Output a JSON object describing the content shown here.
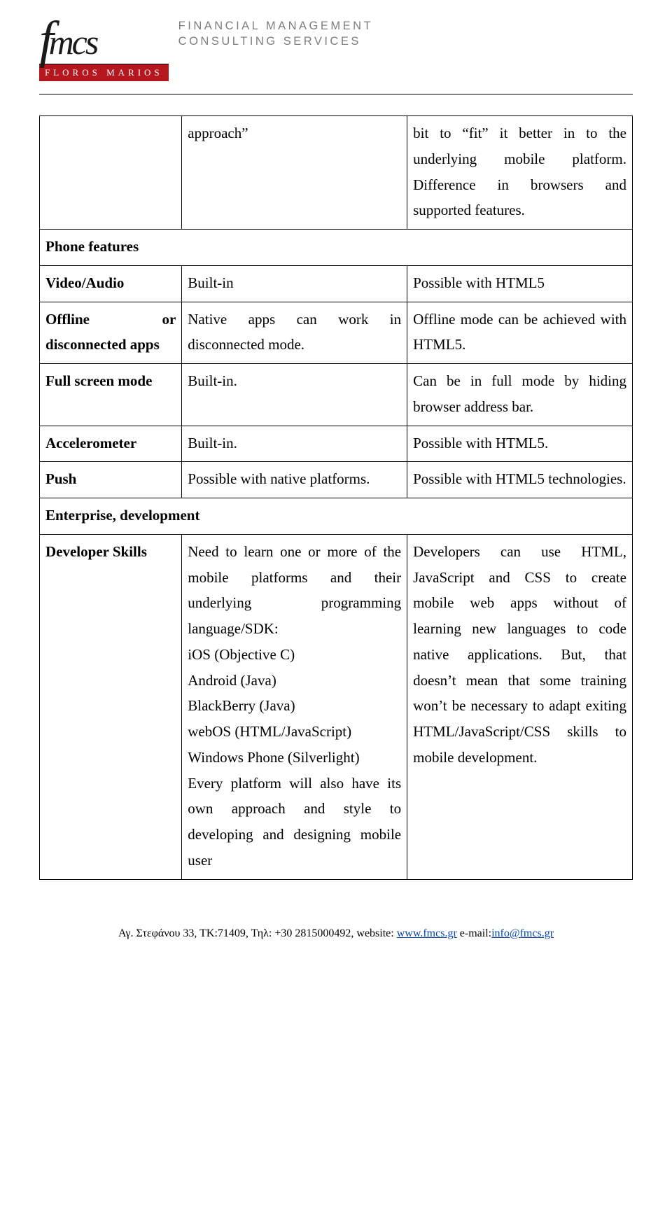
{
  "header": {
    "logo_text": "fmcs",
    "logo_bar": "FLOROS MARIOS",
    "tag_line1": "FINANCIAL MANAGEMENT",
    "tag_line2": "CONSULTING SERVICES"
  },
  "table": {
    "r1_c1": "",
    "r1_c2": "approach”",
    "r1_c3": "bit to “fit” it better in to the underlying mobile platform. Difference in browsers and supported features.",
    "r2_c1": "Phone features",
    "r3_c1": "Video/Audio",
    "r3_c2": "Built-in",
    "r3_c3": "Possible with HTML5",
    "r4_c1": "Offline or disconnected apps",
    "r4_c2": "Native apps can work in disconnected mode.",
    "r4_c3": "Offline mode can be achieved with HTML5.",
    "r5_c1": "Full screen mode",
    "r5_c2": "Built-in.",
    "r5_c3": "Can be in full mode by hiding browser address bar.",
    "r6_c1": "Accelerometer",
    "r6_c2": "Built-in.",
    "r6_c3": "Possible with HTML5.",
    "r7_c1": "Push",
    "r7_c2": "Possible with native platforms.",
    "r7_c3": "Possible with HTML5 technologies.",
    "r8_c1": "Enterprise, development",
    "r9_c1": "Developer Skills",
    "r9_c2": "Need to learn one or more of the mobile platforms and their underlying programming language/SDK:\niOS (Objective C)\nAndroid (Java)\nBlackBerry (Java)\nwebOS (HTML/JavaScript)\nWindows Phone (Silverlight)\nEvery platform will also have its own approach and style to developing and designing mobile user",
    "r9_c3": "Developers can use HTML, JavaScript and CSS to create mobile web apps without of learning new languages to code native applications. But, that doesn’t mean that some training won’t be necessary to adapt exiting HTML/JavaScript/CSS skills to mobile development."
  },
  "footer": {
    "prefix": "Αγ. Στεφάνου 33, ΤΚ:71409, Τηλ: +30 2815000492, website: ",
    "site": "www.fmcs.gr",
    "middle": " e-mail:",
    "email": "info@fmcs.gr"
  }
}
